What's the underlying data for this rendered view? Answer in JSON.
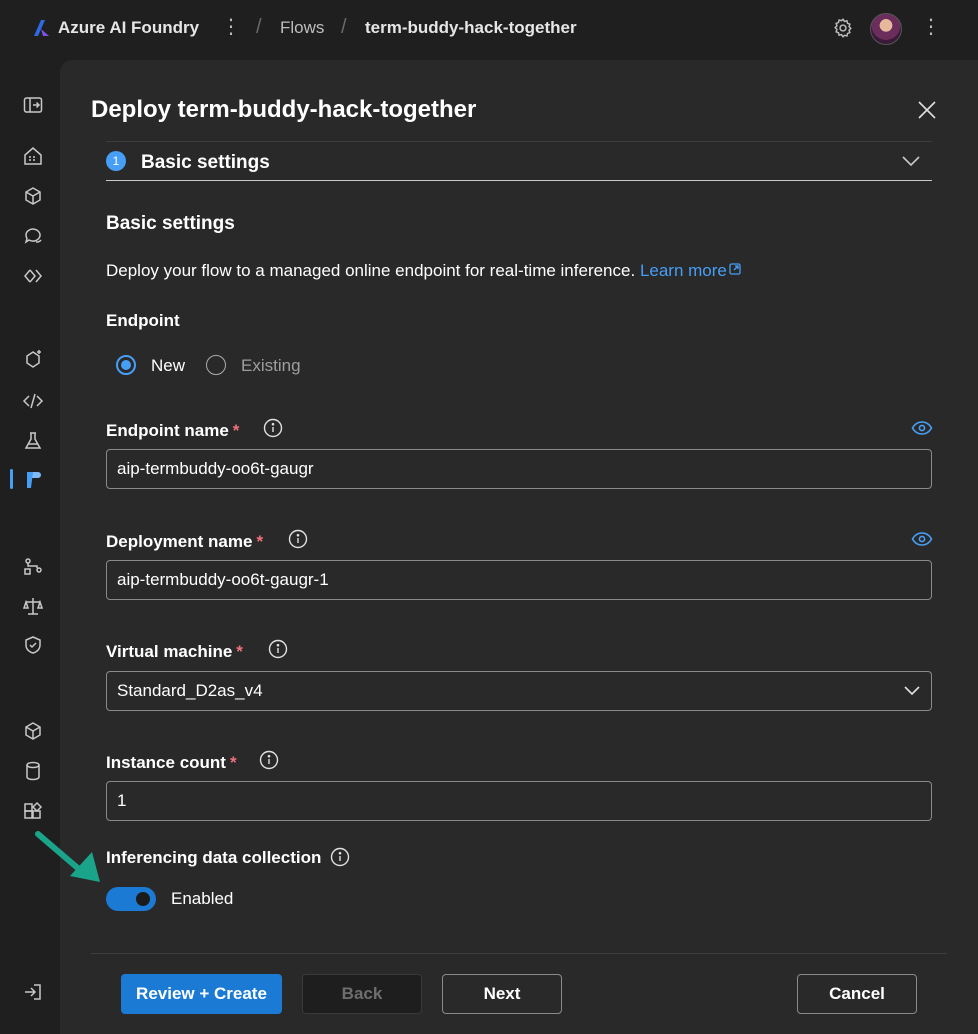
{
  "app": {
    "brand": "Azure AI Foundry"
  },
  "breadcrumb": {
    "section": "Flows",
    "current": "term-buddy-hack-together"
  },
  "panel": {
    "title": "Deploy term-buddy-hack-together",
    "step": {
      "number": "1",
      "title": "Basic settings"
    },
    "section_title": "Basic settings",
    "description": "Deploy your flow to a managed online endpoint for real-time inference.",
    "learn_more": "Learn more",
    "endpoint": {
      "label": "Endpoint",
      "options": [
        "New",
        "Existing"
      ],
      "selected": "New"
    },
    "endpoint_name": {
      "label": "Endpoint name",
      "value": "aip-termbuddy-oo6t-gaugr"
    },
    "deployment_name": {
      "label": "Deployment name",
      "value": "aip-termbuddy-oo6t-gaugr-1"
    },
    "virtual_machine": {
      "label": "Virtual machine",
      "value": "Standard_D2as_v4"
    },
    "instance_count": {
      "label": "Instance count",
      "value": "1"
    },
    "data_collection": {
      "label": "Inferencing data collection",
      "state": "Enabled",
      "enabled": true
    },
    "required_mark": "*"
  },
  "footer": {
    "review_create": "Review + Create",
    "back": "Back",
    "next": "Next",
    "cancel": "Cancel"
  },
  "colors": {
    "accent": "#479ef5",
    "primary_button": "#1a7ad4",
    "required": "#f1707b",
    "annotation_arrow": "#1aa58a"
  },
  "icons": {
    "rail": [
      "collapse-panel-icon",
      "home-icon",
      "model-catalog-icon",
      "chat-icon",
      "compare-icon",
      "ai-services-icon",
      "code-icon",
      "flask-icon",
      "prompt-flow-icon",
      "tracing-icon",
      "evaluation-icon",
      "safety-icon",
      "models-icon",
      "data-icon",
      "components-icon",
      "sign-out-icon"
    ]
  }
}
